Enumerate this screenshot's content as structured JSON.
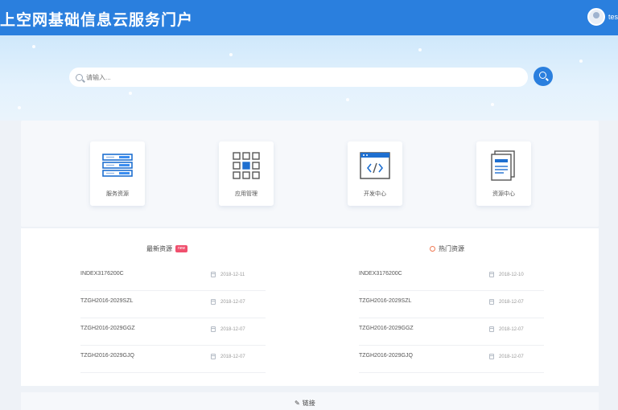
{
  "header": {
    "title": "上空网基础信息云服务门户",
    "username": "test",
    "colors": {
      "bar": "#2a7fde"
    }
  },
  "search": {
    "placeholder": "请输入...",
    "icon": "search-icon"
  },
  "quick_tiles": [
    {
      "label": "服务资源",
      "icon": "server-icon"
    },
    {
      "label": "应用管理",
      "icon": "grid-apps-icon"
    },
    {
      "label": "开发中心",
      "icon": "code-window-icon"
    },
    {
      "label": "资源中心",
      "icon": "document-icon"
    }
  ],
  "latest": {
    "title": "最新资源",
    "badge": "new",
    "rows": [
      {
        "name": "INDEX3176200C",
        "date": "2018-12-11"
      },
      {
        "name": "TZGH2016-2029SZL",
        "date": "2018-12-07"
      },
      {
        "name": "TZGH2016-2029GGZ",
        "date": "2018-12-07"
      },
      {
        "name": "TZGH2016-2029GJQ",
        "date": "2018-12-07"
      }
    ]
  },
  "hot": {
    "title": "热门资源",
    "rows": [
      {
        "name": "INDEX3176200C",
        "date": "2018-12-10"
      },
      {
        "name": "TZGH2016-2029SZL",
        "date": "2018-12-07"
      },
      {
        "name": "TZGH2016-2029GGZ",
        "date": "2018-12-07"
      },
      {
        "name": "TZGH2016-2029GJQ",
        "date": "2018-12-07"
      }
    ]
  },
  "bottom": {
    "link_label": "链接"
  }
}
